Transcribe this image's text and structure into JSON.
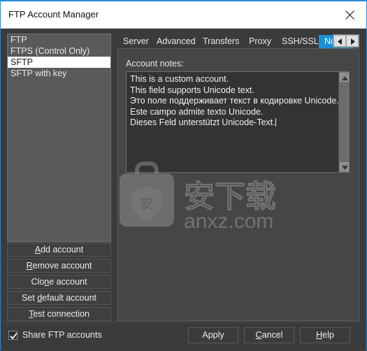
{
  "window": {
    "title": "FTP Account Manager",
    "close_icon": "close-icon",
    "accent_color": "#2b8ad6"
  },
  "accounts": {
    "items": [
      {
        "label": "FTP",
        "selected": false
      },
      {
        "label": "FTPS (Control Only)",
        "selected": false
      },
      {
        "label": "SFTP",
        "selected": true
      },
      {
        "label": "SFTP with key",
        "selected": false
      }
    ]
  },
  "side_buttons": [
    {
      "pre": "",
      "key": "A",
      "post": "dd account"
    },
    {
      "pre": "",
      "key": "R",
      "post": "emove account"
    },
    {
      "pre": "Clo",
      "key": "n",
      "post": "e account"
    },
    {
      "pre": "Set ",
      "key": "d",
      "post": "efault account"
    },
    {
      "pre": "",
      "key": "T",
      "post": "est connection"
    }
  ],
  "tabs": {
    "items": [
      {
        "label": "Server",
        "active": false
      },
      {
        "label": "Advanced",
        "active": false
      },
      {
        "label": "Transfers",
        "active": false
      },
      {
        "label": "Proxy",
        "active": false
      },
      {
        "label": "SSH/SSL",
        "active": false
      },
      {
        "label": "Notes",
        "active": true
      }
    ],
    "scroll_left_icon": "arrow-left-icon",
    "scroll_right_icon": "arrow-right-icon",
    "active_tab_color": "#1b8fd6"
  },
  "notes_panel": {
    "label": "Account notes:",
    "value": "This is a custom account.\nThis field supports Unicode text.\nЭто поле поддерживает текст в кодировке Unicode.\nEste campo admite texto Unicode.\nDieses Feld unterstützt Unicode-Text.",
    "scroll_up_icon": "scroll-up-icon",
    "scroll_down_icon": "scroll-down-icon"
  },
  "watermark": {
    "brand_char": "安",
    "site": "anxz.com",
    "logo_icon": "briefcase-shield-logo"
  },
  "footer": {
    "share_checkbox": {
      "label": "Share FTP accounts",
      "checked": true,
      "check_icon": "checkmark-icon"
    },
    "buttons": [
      {
        "pre": "Apply",
        "key": "",
        "post": ""
      },
      {
        "pre": "",
        "key": "C",
        "post": "ancel"
      },
      {
        "pre": "",
        "key": "H",
        "post": "elp"
      }
    ]
  }
}
